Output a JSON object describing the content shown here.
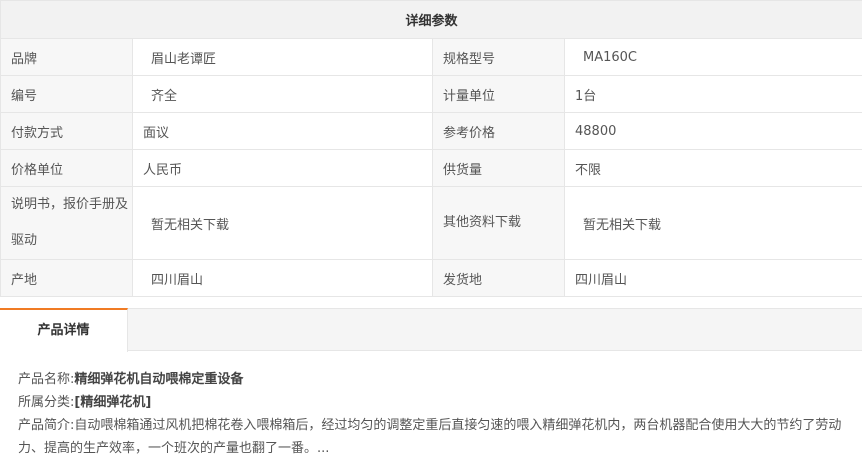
{
  "params_title": "详细参数",
  "rows": [
    {
      "l1": "品牌",
      "v1": "眉山老谭匠",
      "l2": "规格型号",
      "v2": "MA160C"
    },
    {
      "l1": "编号",
      "v1": "齐全",
      "l2": "计量单位",
      "v2": "1台"
    },
    {
      "l1": "付款方式",
      "v1": "面议",
      "l2": "参考价格",
      "v2": "48800"
    },
    {
      "l1": "价格单位",
      "v1": "人民币",
      "l2": "供货量",
      "v2": "不限"
    },
    {
      "l1": "说明书，报价手册及驱动",
      "v1": "暂无相关下载",
      "l2": "其他资料下载",
      "v2": "暂无相关下载"
    },
    {
      "l1": "产地",
      "v1": "四川眉山",
      "l2": "发货地",
      "v2": "四川眉山"
    }
  ],
  "tab_label": "产品详情",
  "detail": {
    "name_label": "产品名称:",
    "name_value": "精细弹花机自动喂棉定重设备",
    "category_label": "所属分类:",
    "category_value": "[精细弹花机]",
    "intro_label": "产品简介:",
    "intro_value": "自动喂棉箱通过风机把棉花卷入喂棉箱后，经过均匀的调整定重后直接匀速的喂入精细弹花机内，两台机器配合使用大大的节约了劳动力、提高的生产效率，一个班次的产量也翻了一番。..."
  }
}
